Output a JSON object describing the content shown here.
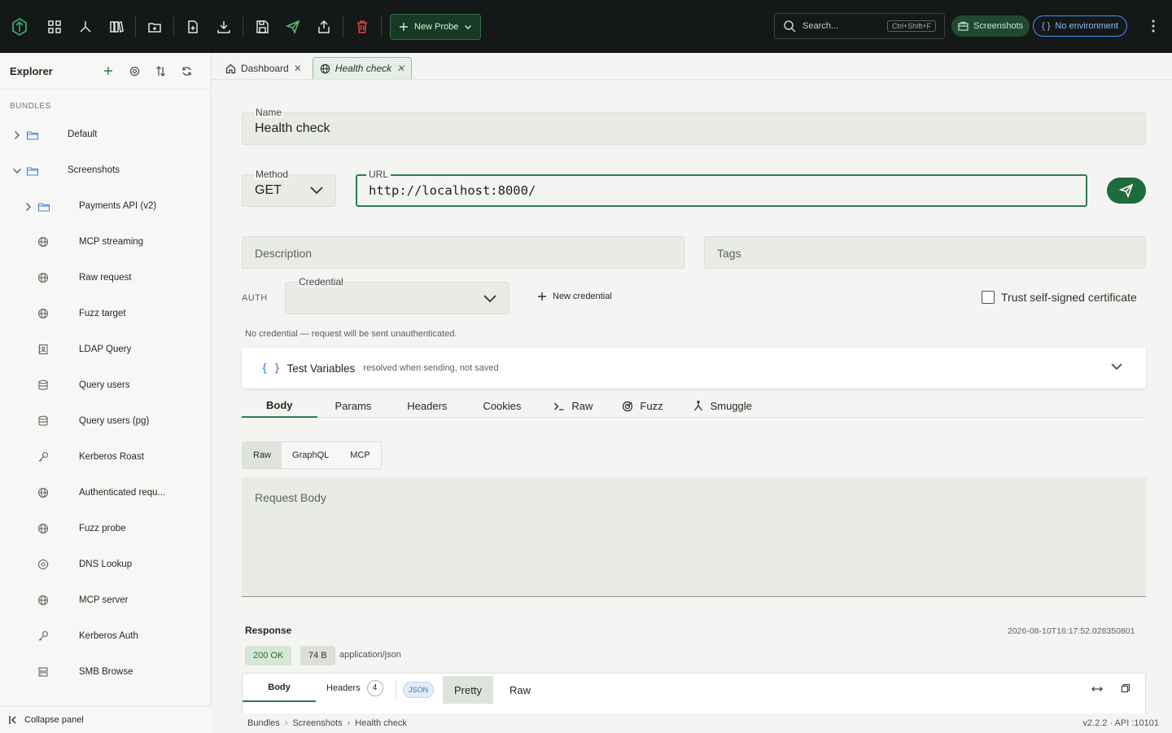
{
  "topbar": {
    "new_probe_label": "New Probe",
    "search_placeholder": "Search...",
    "search_shortcut": "Ctrl+Shift+F",
    "workspace_chip": "Screenshots",
    "env_brace": "{ }",
    "env_chip": "No environment"
  },
  "sidebar": {
    "title": "Explorer",
    "section": "BUNDLES",
    "collapse_label": "Collapse panel",
    "items": [
      {
        "label": "Default",
        "icon": "folder-icon",
        "level": 0,
        "chevron": "right"
      },
      {
        "label": "Screenshots",
        "icon": "folder-icon",
        "level": 0,
        "chevron": "down"
      },
      {
        "label": "Payments API (v2)",
        "icon": "folder-icon",
        "level": 1,
        "chevron": "right"
      },
      {
        "label": "MCP streaming",
        "icon": "globe-icon",
        "level": 1
      },
      {
        "label": "Raw request",
        "icon": "globe-icon",
        "level": 1
      },
      {
        "label": "Fuzz target",
        "icon": "globe-icon",
        "level": 1
      },
      {
        "label": "LDAP Query",
        "icon": "contact-book-icon",
        "level": 1
      },
      {
        "label": "Query users",
        "icon": "database-icon",
        "level": 1
      },
      {
        "label": "Query users (pg)",
        "icon": "database-icon",
        "level": 1
      },
      {
        "label": "Kerberos Roast",
        "icon": "key-icon",
        "level": 1
      },
      {
        "label": "Authenticated requ...",
        "icon": "globe-icon",
        "level": 1
      },
      {
        "label": "Fuzz probe",
        "icon": "globe-icon",
        "level": 1
      },
      {
        "label": "DNS Lookup",
        "icon": "dns-icon",
        "level": 1
      },
      {
        "label": "MCP server",
        "icon": "globe-icon",
        "level": 1
      },
      {
        "label": "Kerberos Auth",
        "icon": "key-icon",
        "level": 1
      },
      {
        "label": "SMB Browse",
        "icon": "server-icon",
        "level": 1
      }
    ]
  },
  "tabs": [
    {
      "label": "Dashboard",
      "icon": "home-icon"
    },
    {
      "label": "Health check",
      "icon": "globe-icon"
    }
  ],
  "form": {
    "name_label": "Name",
    "name_value": "Health check",
    "method_label": "Method",
    "method_value": "GET",
    "url_label": "URL",
    "url_value": "http://localhost:8000/",
    "description_placeholder": "Description",
    "tags_placeholder": "Tags",
    "auth_label": "AUTH",
    "credential_label": "Credential",
    "new_credential_label": "New credential",
    "trust_label": "Trust self-signed certificate",
    "credential_note": "No credential — request will be sent unauthenticated."
  },
  "test_variables": {
    "brace": "{ }",
    "title": "Test Variables",
    "subtitle": "resolved when sending, not saved"
  },
  "request_tabs": [
    {
      "label": "Body",
      "icon": ""
    },
    {
      "label": "Params",
      "icon": ""
    },
    {
      "label": "Headers",
      "icon": ""
    },
    {
      "label": "Cookies",
      "icon": ""
    },
    {
      "label": "Raw",
      "icon": "terminal-icon"
    },
    {
      "label": "Fuzz",
      "icon": "target-icon"
    },
    {
      "label": "Smuggle",
      "icon": "split-icon"
    }
  ],
  "body_modes": [
    "Raw",
    "GraphQL",
    "MCP"
  ],
  "request_body_placeholder": "Request Body",
  "response": {
    "title": "Response",
    "timestamp": "2026-08-10T16:17:52.028350801",
    "status": "200 OK",
    "size": "74 B",
    "content_type": "application/json",
    "tabs": {
      "body": "Body",
      "headers": "Headers",
      "headers_count": "4"
    },
    "format_chip": "JSON",
    "pretty": "Pretty",
    "raw": "Raw"
  },
  "statusbar": {
    "breadcrumb": [
      "Bundles",
      "Screenshots",
      "Health check"
    ],
    "version": "v2.2.2 · API :10101"
  },
  "colors": {
    "accent": "#2e7d4f",
    "topbar": "#141816",
    "delete": "#e04646",
    "send": "#1e6b3c"
  }
}
